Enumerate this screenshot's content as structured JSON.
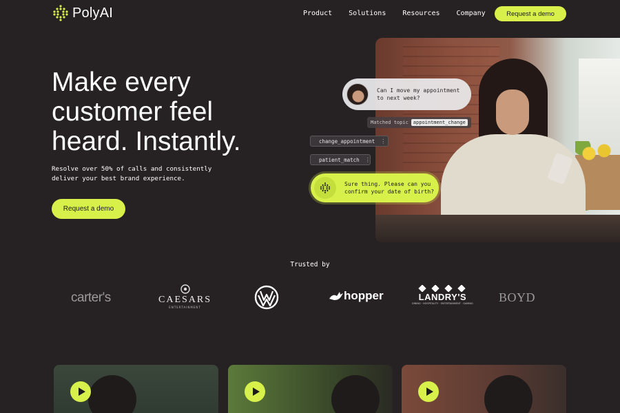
{
  "brand": {
    "name": "PolyAI",
    "accent": "#d7f14a",
    "background": "#262223"
  },
  "nav": {
    "links": [
      "Product",
      "Solutions",
      "Resources",
      "Company"
    ],
    "cta": "Request a demo"
  },
  "hero": {
    "title_lines": [
      "Make every",
      "customer feel",
      "heard. Instantly."
    ],
    "subtitle_lines": [
      "Resolve over 50% of calls and consistently",
      "deliver your best brand experience."
    ],
    "cta": "Request a demo"
  },
  "chat": {
    "question_lines": [
      "Can I move my appointment",
      "to next week?"
    ],
    "matched_label": "Matched topic",
    "matched_value": "appointment_change",
    "actions": [
      {
        "label": "change_appointment",
        "menu": "⋮"
      },
      {
        "label": "patient_match",
        "menu": "⋮"
      }
    ],
    "answer_lines": [
      "Sure thing. Please can you",
      "confirm your date of birth?"
    ]
  },
  "trusted": {
    "label": "Trusted by",
    "logos": [
      {
        "name": "carter's",
        "text": "carter's"
      },
      {
        "name": "caesars",
        "text": "CAESARS",
        "sub": "ENTERTAINMENT"
      },
      {
        "name": "volkswagen",
        "icon": "vw-logo"
      },
      {
        "name": "hopper",
        "text": "hopper"
      },
      {
        "name": "landrys",
        "text": "LANDRY'S",
        "sub": "DINING · HOSPITALITY · ENTERTAINMENT · GAMING"
      },
      {
        "name": "boyd",
        "text": "BOYD"
      }
    ]
  },
  "videos": [
    {
      "icon": "play-icon"
    },
    {
      "icon": "play-icon"
    },
    {
      "icon": "play-icon"
    }
  ]
}
